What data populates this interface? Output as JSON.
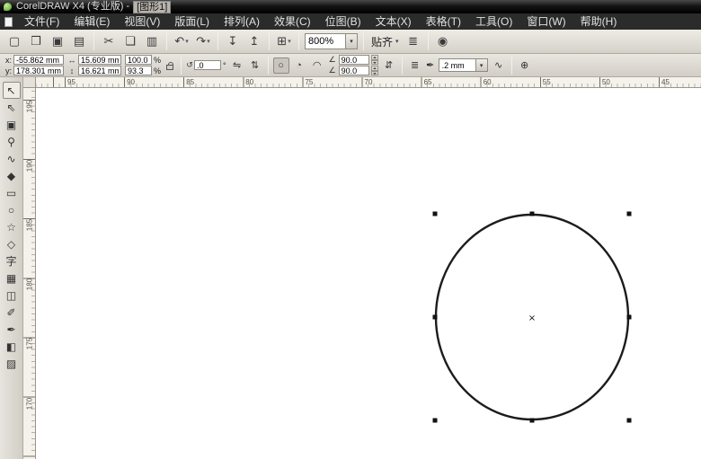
{
  "window": {
    "title_app": "CorelDRAW X4 (专业版) -",
    "title_doc": "[图形1]"
  },
  "menu_bar": {
    "items": [
      "文件(F)",
      "编辑(E)",
      "视图(V)",
      "版面(L)",
      "排列(A)",
      "效果(C)",
      "位图(B)",
      "文本(X)",
      "表格(T)",
      "工具(O)",
      "窗口(W)",
      "帮助(H)"
    ]
  },
  "standard_toolbar": {
    "buttons": [
      {
        "name": "new-document-icon",
        "glyph": "▢"
      },
      {
        "name": "open-icon",
        "glyph": "❒"
      },
      {
        "name": "save-icon",
        "glyph": "▣"
      },
      {
        "name": "print-icon",
        "glyph": "▤"
      },
      {
        "name": "separator"
      },
      {
        "name": "cut-icon",
        "glyph": "✂"
      },
      {
        "name": "copy-icon",
        "glyph": "❏"
      },
      {
        "name": "paste-icon",
        "glyph": "▥"
      },
      {
        "name": "separator"
      },
      {
        "name": "undo-icon",
        "glyph": "↶",
        "dropdown": true
      },
      {
        "name": "redo-icon",
        "glyph": "↷",
        "dropdown": true
      },
      {
        "name": "separator"
      },
      {
        "name": "import-icon",
        "glyph": "↧"
      },
      {
        "name": "export-icon",
        "glyph": "↥"
      },
      {
        "name": "separator"
      },
      {
        "name": "app-launcher-icon",
        "glyph": "⊞",
        "dropdown": true
      },
      {
        "name": "separator"
      }
    ],
    "zoom_value": "800%",
    "snap_label": "贴齐",
    "options_glyph": "≣",
    "welcome_glyph": "◉",
    "chevron": "▾"
  },
  "property_bar": {
    "position": {
      "x_label": "x:",
      "x_value": "-55.862 mm",
      "y_label": "y:",
      "y_value": "178.301 mm"
    },
    "size": {
      "width_value": "15.609 mm",
      "height_value": "16.621 mm"
    },
    "scale": {
      "h_value": "100.0",
      "v_value": "93.3",
      "unit": "%"
    },
    "rotation": {
      "value": ".0",
      "unit": "°"
    },
    "arc_angles": {
      "start": "90.0",
      "end": "90.0"
    },
    "outline_width": ".2 mm",
    "icons": {
      "width": "↔",
      "height": "↕",
      "rotate": "↺",
      "mirror_h": "⇋",
      "mirror_v": "⇅",
      "ellipse": "○",
      "pie": "◔",
      "arc": "◠",
      "angle": "∠",
      "direction": "⇵",
      "wrap": "≣",
      "outline_pen": "✒",
      "convert_curves": "∿",
      "quick_customize": "⊕",
      "chevron": "▾"
    }
  },
  "toolbox": {
    "tools": [
      {
        "name": "pick-tool",
        "glyph": "↖"
      },
      {
        "name": "shape-tool",
        "glyph": "⇖"
      },
      {
        "name": "crop-tool",
        "glyph": "▣"
      },
      {
        "name": "zoom-tool",
        "glyph": "⚲"
      },
      {
        "name": "freehand-tool",
        "glyph": "∿"
      },
      {
        "name": "smart-fill-tool",
        "glyph": "◆"
      },
      {
        "name": "rectangle-tool",
        "glyph": "▭"
      },
      {
        "name": "ellipse-tool",
        "glyph": "○"
      },
      {
        "name": "polygon-tool",
        "glyph": "☆"
      },
      {
        "name": "basic-shapes-tool",
        "glyph": "◇"
      },
      {
        "name": "text-tool",
        "glyph": "字"
      },
      {
        "name": "table-tool",
        "glyph": "▦"
      },
      {
        "name": "interactive-blend-tool",
        "glyph": "◫"
      },
      {
        "name": "eyedropper-tool",
        "glyph": "✐"
      },
      {
        "name": "outline-pen-tool",
        "glyph": "✒"
      },
      {
        "name": "fill-tool",
        "glyph": "◧"
      },
      {
        "name": "interactive-fill-tool",
        "glyph": "▨"
      }
    ]
  },
  "rulers": {
    "horizontal": [
      "95",
      "90",
      "85",
      "80",
      "75",
      "70",
      "65",
      "60",
      "55",
      "50",
      "45"
    ],
    "vertical": [
      "195",
      "190",
      "185",
      "180",
      "175",
      "170"
    ]
  },
  "canvas": {
    "center_marker": "×"
  },
  "colors": {
    "titlebar_bg": "#141414",
    "menubar_bg": "#2b2b2b",
    "toolbar_bg": "#d8d4cc",
    "ruler_bg": "#f4f2ea",
    "canvas_bg": "#ffffff",
    "shape_outline": "#1c1c1c",
    "selection_handle": "#111111"
  }
}
